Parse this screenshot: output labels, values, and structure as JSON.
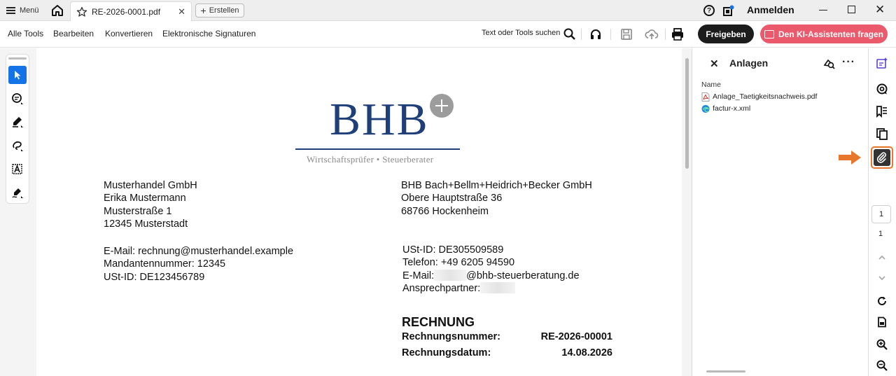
{
  "titlebar": {
    "menu_label": "Menü",
    "tab_name": "RE-2026-0001.pdf",
    "create_label": "Erstellen",
    "signin_label": "Anmelden",
    "help_glyph": "?"
  },
  "toolbar": {
    "items": [
      "Alle Tools",
      "Bearbeiten",
      "Konvertieren",
      "Elektronische Signaturen"
    ],
    "search_label": "Text oder Tools suchen",
    "share_label": "Freigeben",
    "ai_label": "Den KI-Assistenten fragen"
  },
  "document": {
    "logo_text": "BHB",
    "logo_subtitle": "Wirtschaftsprüfer • Steuerberater",
    "recipient": [
      "Musterhandel GmbH",
      "Erika Mustermann",
      "Musterstraße 1",
      "12345 Musterstadt"
    ],
    "recipient_contact": [
      "E-Mail: rechnung@musterhandel.example",
      "Mandantennummer: 12345",
      "USt-ID: DE123456789"
    ],
    "sender": [
      "BHB Bach+Bellm+Heidrich+Becker GmbH",
      "Obere Hauptstraße 36",
      "68766 Hockenheim"
    ],
    "sender_contact": {
      "vat": "USt-ID: DE305509589",
      "phone": "Telefon: +49 6205 94590",
      "email_prefix": "E-Mail:",
      "email_domain": "@bhb-steuerberatung.de",
      "contact_label": "Ansprechpartner:"
    },
    "invoice_title": "RECHNUNG",
    "invoice_number_label": "Rechnungsnummer:",
    "invoice_number": "RE-2026-00001",
    "invoice_date_label": "Rechnungsdatum:",
    "invoice_date": "14.08.2026"
  },
  "attachments": {
    "title": "Anlagen",
    "column_name": "Name",
    "files": [
      {
        "name": "Anlage_Taetigkeitsnachweis.pdf",
        "icon": "pdf-file-icon"
      },
      {
        "name": "factur-x.xml",
        "icon": "edge-xml-file-icon"
      }
    ]
  },
  "pagination": {
    "current_page": "1",
    "total_pages": "1"
  },
  "colors": {
    "accent_blue": "#1473e6",
    "share_button": "#1c1c1c",
    "ai_button": "#ea5a6c",
    "highlight_orange": "#e8772e",
    "logo_blue": "#1f3f78"
  }
}
